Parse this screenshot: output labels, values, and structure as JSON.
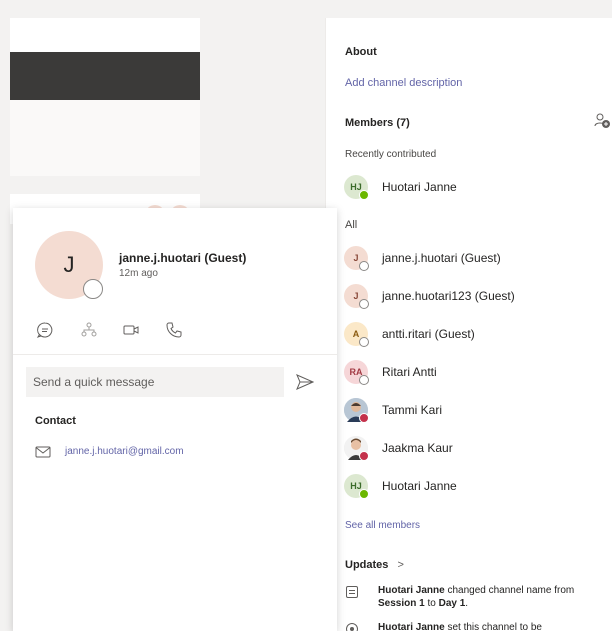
{
  "right_panel": {
    "about_heading": "About",
    "add_description": "Add channel description",
    "members_heading": "Members (7)",
    "recently_contributed": "Recently contributed",
    "recent_members": [
      {
        "initials": "HJ",
        "name": "Huotari Janne",
        "status": "available"
      }
    ],
    "all_heading": "All",
    "members": [
      {
        "initials": "J",
        "name": "janne.j.huotari (Guest)",
        "status": "offline"
      },
      {
        "initials": "J",
        "name": "janne.huotari123 (Guest)",
        "status": "offline"
      },
      {
        "initials": "A",
        "name": "antti.ritari (Guest)",
        "status": "offline"
      },
      {
        "initials": "RA",
        "name": "Ritari Antti",
        "status": "offline"
      },
      {
        "initials": "",
        "name": "Tammi Kari",
        "status": "busy"
      },
      {
        "initials": "",
        "name": "Jaakma Kaur",
        "status": "busy"
      },
      {
        "initials": "HJ",
        "name": "Huotari Janne",
        "status": "available"
      }
    ],
    "see_all": "See all members",
    "updates_heading": "Updates",
    "updates_chevron": ">",
    "updates": [
      {
        "actor": "Huotari Janne",
        "text1": " changed channel name from ",
        "bold1": "Session 1",
        "text2": " to ",
        "bold2": "Day 1",
        "text3": "."
      },
      {
        "actor": "Huotari Janne",
        "text1": " set this channel to be",
        "bold1": "",
        "text2": "",
        "bold2": "",
        "text3": ""
      }
    ]
  },
  "contact_card": {
    "avatar_initial": "J",
    "name": "janne.j.huotari (Guest)",
    "last_seen": "12m ago",
    "actions": [
      "chat-icon",
      "org-chart-icon",
      "video-call-icon",
      "phone-call-icon"
    ],
    "message_placeholder": "Send a quick message",
    "contact_heading": "Contact",
    "email": "janne.j.huotari@gmail.com"
  },
  "colors": {
    "accent": "#6264a7",
    "available": "#6bb700",
    "busy": "#c4314b",
    "guest_avatar": "#f4dcd2"
  }
}
